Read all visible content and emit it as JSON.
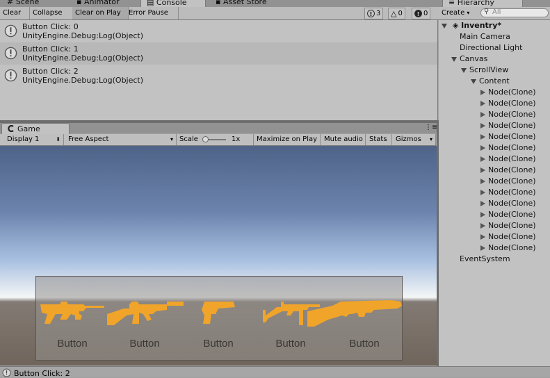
{
  "tabs": {
    "scene": "Scene",
    "animator": "Animator",
    "console": "Console",
    "asset_store": "Asset Store",
    "hierarchy": "Hierarchy",
    "game": "Game"
  },
  "console": {
    "toolbar": {
      "clear": "Clear",
      "collapse": "Collapse",
      "clear_on_play": "Clear on Play",
      "error_pause": "Error Pause"
    },
    "counts": {
      "messages": "3",
      "warnings": "0",
      "errors": "0"
    },
    "logs": [
      {
        "line1": "Button Click: 0",
        "line2": "UnityEngine.Debug:Log(Object)"
      },
      {
        "line1": "Button Click: 1",
        "line2": "UnityEngine.Debug:Log(Object)"
      },
      {
        "line1": "Button Click: 2",
        "line2": "UnityEngine.Debug:Log(Object)"
      }
    ]
  },
  "game": {
    "toolbar": {
      "display": "Display 1",
      "aspect": "Free Aspect",
      "scale_label": "Scale",
      "scale_value": "1x",
      "maximize": "Maximize on Play",
      "mute": "Mute audio",
      "stats": "Stats",
      "gizmos": "Gizmos"
    },
    "scale_level": 0.0,
    "buttons": [
      {
        "label": "Button",
        "icon": "assault-rifle-icon"
      },
      {
        "label": "Button",
        "icon": "tommy-gun-icon"
      },
      {
        "label": "Button",
        "icon": "pistol-icon"
      },
      {
        "label": "Button",
        "icon": "submachine-gun-icon"
      },
      {
        "label": "Button",
        "icon": "rifle-icon"
      }
    ],
    "colors": {
      "gun": "#f0a429",
      "panel_text": "#3a3733"
    }
  },
  "hierarchy": {
    "create": "Create",
    "search_placeholder": "All",
    "scene_name": "Inventry*",
    "items": {
      "main_camera": "Main Camera",
      "directional_light": "Directional Light",
      "canvas": "Canvas",
      "scroll_view": "ScrollView",
      "content": "Content",
      "event_system": "EventSystem"
    },
    "nodes": [
      "Node(Clone)",
      "Node(Clone)",
      "Node(Clone)",
      "Node(Clone)",
      "Node(Clone)",
      "Node(Clone)",
      "Node(Clone)",
      "Node(Clone)",
      "Node(Clone)",
      "Node(Clone)",
      "Node(Clone)",
      "Node(Clone)",
      "Node(Clone)",
      "Node(Clone)",
      "Node(Clone)"
    ]
  },
  "status_bar": {
    "message": "Button Click: 2"
  }
}
